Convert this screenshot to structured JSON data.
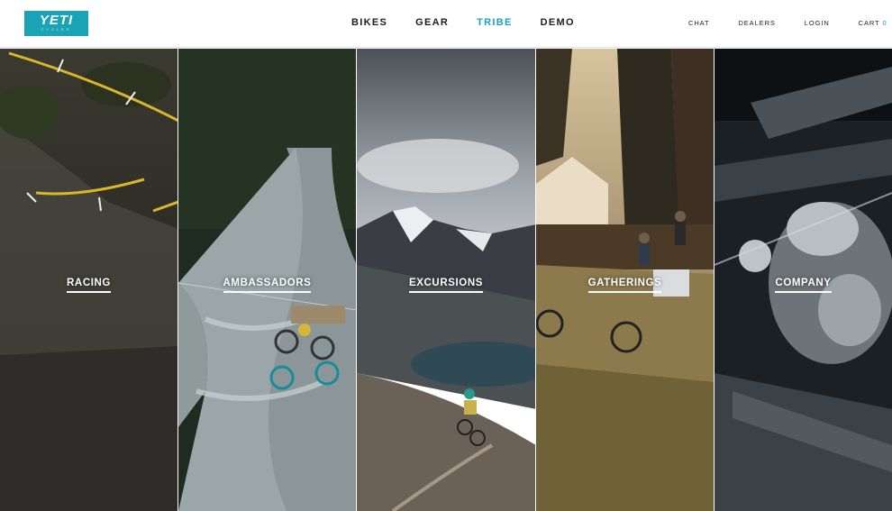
{
  "brand": {
    "logo_text": "YETI",
    "logo_sub": "CYCLES",
    "accent": "#1aa3b5"
  },
  "main_nav": [
    {
      "label": "BIKES",
      "active": false
    },
    {
      "label": "GEAR",
      "active": false
    },
    {
      "label": "TRIBE",
      "active": true
    },
    {
      "label": "DEMO",
      "active": false
    }
  ],
  "util_nav": {
    "chat": "CHAT",
    "dealers": "DEALERS",
    "login": "LOGIN",
    "cart": "CART",
    "cart_count": "0"
  },
  "panels": [
    {
      "label": "RACING",
      "image": "mountain-bike race course with yellow tape"
    },
    {
      "label": "AMBASSADORS",
      "image": "riders crossing a river on a cable cart"
    },
    {
      "label": "EXCURSIONS",
      "image": "rider descending a mountain trail"
    },
    {
      "label": "GATHERINGS",
      "image": "camp with bikes in a forest at sunset"
    },
    {
      "label": "COMPANY",
      "image": "welding a bike frame in the workshop"
    }
  ]
}
